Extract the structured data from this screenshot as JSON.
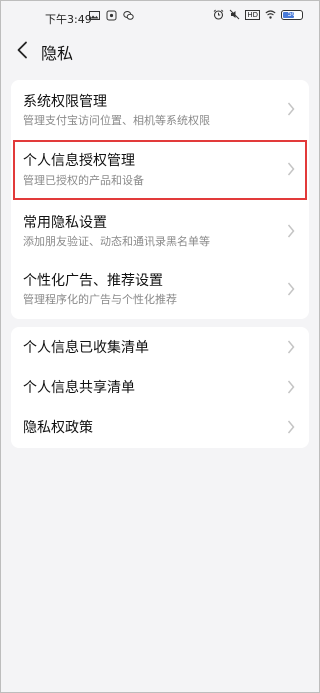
{
  "status_bar": {
    "time": "下午3:49",
    "left_icons": [
      "image-icon",
      "app-icon",
      "wechat-icon"
    ],
    "right_icons": [
      "alarm-icon",
      "silent-icon",
      "hd-icon",
      "wifi-icon",
      "battery-icon"
    ],
    "hd_label": "HD",
    "battery_percent": "50"
  },
  "header": {
    "title": "隐私"
  },
  "section1": {
    "items": [
      {
        "title": "系统权限管理",
        "subtitle": "管理支付宝访问位置、相机等系统权限"
      },
      {
        "title": "个人信息授权管理",
        "subtitle": "管理已授权的产品和设备"
      },
      {
        "title": "常用隐私设置",
        "subtitle": "添加朋友验证、动态和通讯录黑名单等"
      },
      {
        "title": "个性化广告、推荐设置",
        "subtitle": "管理程序化的广告与个性化推荐"
      }
    ]
  },
  "section2": {
    "items": [
      {
        "title": "个人信息已收集清单"
      },
      {
        "title": "个人信息共享清单"
      },
      {
        "title": "隐私权政策"
      }
    ]
  },
  "colors": {
    "background": "#f4f4f6",
    "card": "#ffffff",
    "highlight": "#e23a3a",
    "battery": "#4a7bd8"
  }
}
